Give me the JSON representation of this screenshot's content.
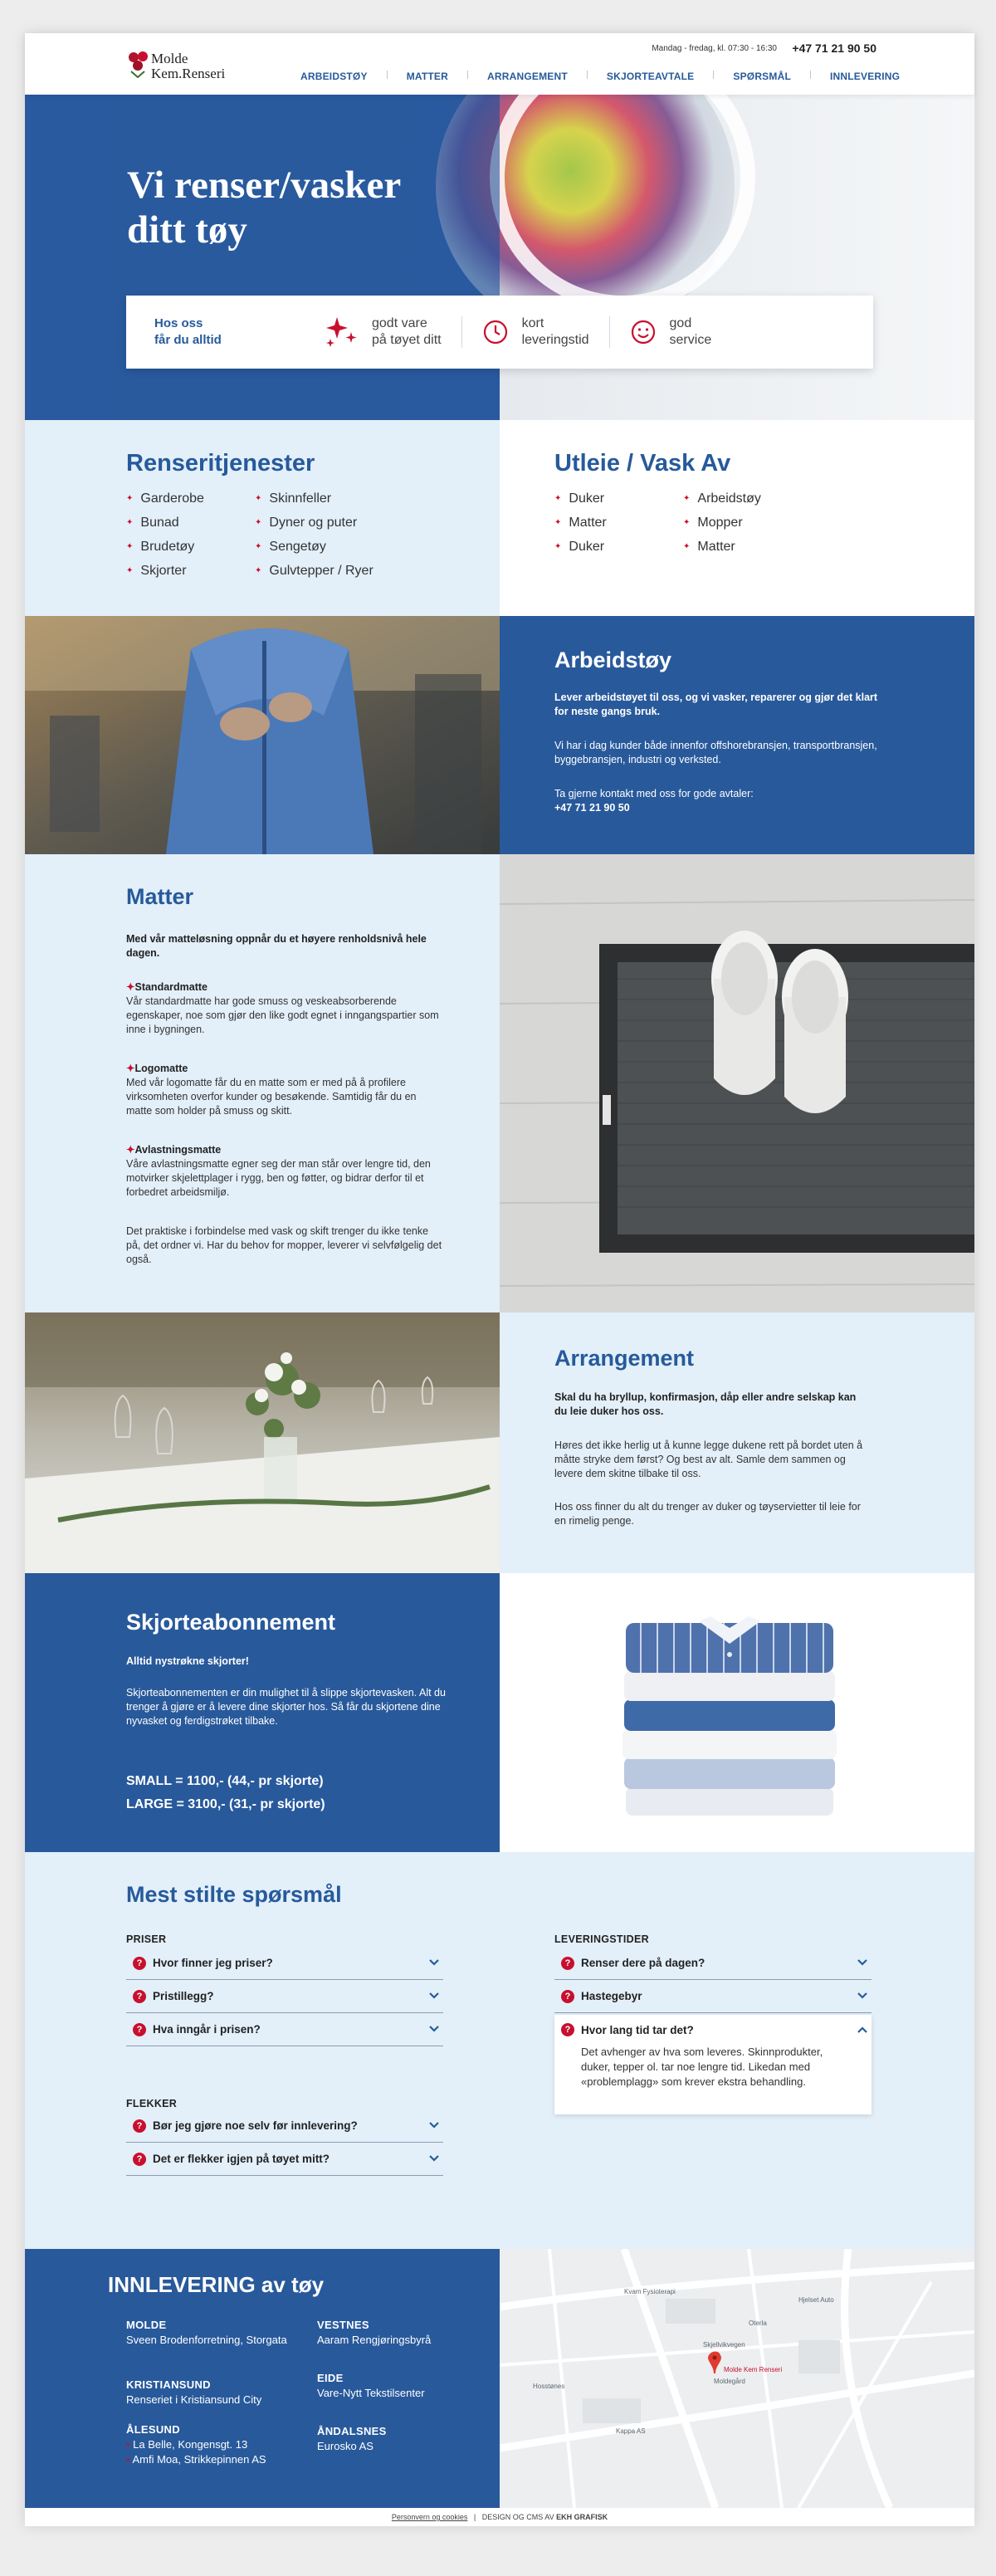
{
  "header": {
    "logo_line1": "Molde",
    "logo_line2": "Kem.Renseri",
    "hours": "Mandag - fredag, kl. 07:30 - 16:30",
    "phone": "+47 71 21 90 50",
    "nav": [
      "Arbeidstøy",
      "Matter",
      "Arrangement",
      "Skjorteavtale",
      "Spørsmål",
      "Innlevering"
    ]
  },
  "hero": {
    "title_line1": "Vi renser/vasker",
    "title_line2": "ditt tøy",
    "bar_intro_line1": "Hos oss",
    "bar_intro_line2": "får du alltid",
    "features": [
      {
        "icon": "sparkle-icon",
        "line1": "godt vare",
        "line2": "på tøyet ditt"
      },
      {
        "icon": "clock-icon",
        "line1": "kort",
        "line2": "leveringstid"
      },
      {
        "icon": "smiley-icon",
        "line1": "god",
        "line2": "service"
      }
    ]
  },
  "services": {
    "left_title": "Renseritjenester",
    "left_col1": [
      "Garderobe",
      "Bunad",
      "Brudetøy",
      "Skjorter"
    ],
    "left_col2": [
      "Skinnfeller",
      "Dyner og puter",
      "Sengetøy",
      "Gulvtepper / Ryer"
    ],
    "right_title": "Utleie / Vask Av",
    "right_col1": [
      "Duker",
      "Matter",
      "Duker"
    ],
    "right_col2": [
      "Arbeidstøy",
      "Mopper",
      "Matter"
    ]
  },
  "arbeid": {
    "title": "Arbeidstøy",
    "lead": "Lever arbeidstøyet til oss, og vi vasker, reparerer og gjør det klart for neste gangs bruk.",
    "text": "Vi har i dag kunder både innenfor offshorebransjen, transportbransjen, byggebransjen, industri og verksted.",
    "contact": "Ta gjerne kontakt med oss for gode avtaler:",
    "phone": "+47 71 21 90 50"
  },
  "matter": {
    "title": "Matter",
    "lead": "Med vår matteløsning oppnår du et høyere renholdsnivå hele dagen.",
    "items": [
      {
        "title": "Standardmatte",
        "text": "Vår standardmatte har gode smuss og veskeabsorberende egenskaper, noe som gjør den like godt egnet i inngangspartier som inne i bygningen."
      },
      {
        "title": "Logomatte",
        "text": "Med vår logomatte får du en matte som er med på å profilere virksomheten overfor kunder og besøkende. Samtidig får du en matte som holder på smuss og skitt."
      },
      {
        "title": "Avlastningsmatte",
        "text": "Våre avlastningsmatte egner seg der man står over lengre tid, den motvirker skjelettplager i rygg, ben og føtter, og bidrar derfor til et forbedret arbeidsmiljø."
      }
    ],
    "outro": "Det praktiske i forbindelse med vask og skift trenger du ikke tenke på, det ordner vi. Har du behov for mopper, leverer vi selvfølgelig det også."
  },
  "arrangement": {
    "title": "Arrangement",
    "lead": "Skal du ha bryllup, konfirmasjon, dåp eller andre selskap kan du leie duker hos oss.",
    "text1": "Høres det ikke herlig ut å kunne legge dukene rett på bordet uten å måtte stryke dem først? Og best av alt. Samle dem sammen og levere dem skitne tilbake til oss.",
    "text2": "Hos oss finner du alt du trenger av duker og tøyservietter til leie for en rimelig penge."
  },
  "skjorte": {
    "title": "Skjorteabonnement",
    "lead": "Alltid nystrøkne skjorter!",
    "text": "Skjorteabonnementen er din mulighet til å slippe skjortevasken. Alt du trenger å gjøre er å levere dine skjorter hos. Så får du skjortene dine nyvasket og ferdigstrøket tilbake.",
    "small": "SMALL = 1100,- (44,- pr skjorte)",
    "large": "LARGE = 3100,- (31,- pr skjorte)"
  },
  "faq": {
    "title": "Mest stilte spørsmål",
    "groups": [
      {
        "heading": "PRISER",
        "questions": [
          "Hvor finner jeg priser?",
          "Pristillegg?",
          "Hva inngår i prisen?"
        ]
      },
      {
        "heading": "FLEKKER",
        "questions": [
          "Bør jeg gjøre noe selv før innlevering?",
          "Det er flekker igjen på tøyet mitt?"
        ]
      },
      {
        "heading": "LEVERINGSTIDER",
        "questions": [
          "Renser dere på dagen?",
          "Hastegebyr",
          "Hvor lang tid tar det?"
        ]
      }
    ],
    "open_answer": "Det avhenger av hva som leveres. Skinnprodukter, duker, tepper ol. tar noe lengre tid. Likedan med «problemplagg» som krever ekstra behandling."
  },
  "delivery": {
    "title": "INNLEVERING av tøy",
    "molde_label": "MOLDE",
    "molde_value": "Sveen Brodenforretning, Storgata",
    "kristiansund_label": "KRISTIANSUND",
    "kristiansund_value": "Renseriet i Kristiansund City",
    "alesund_label": "ÅLESUND",
    "alesund_values": [
      "La Belle, Kongensgt. 13",
      "Amfi Moa, Strikkepinnen AS"
    ],
    "vestnes_label": "VESTNES",
    "vestnes_value": "Aaram Rengjøringsbyrå",
    "eide_label": "EIDE",
    "eide_value": "Vare-Nytt Tekstilsenter",
    "andalsnes_label": "ÅNDALSNES",
    "andalsnes_value": "Eurosko AS",
    "map_labels": [
      "Molde Kem Renseri",
      "Moldegård",
      "Kvam Fysioterapi",
      "Hjelset Auto",
      "Skjellvikvegen",
      "Hosstønes",
      "Kappa AS",
      "Oterla"
    ]
  },
  "footer": {
    "privacy": "Personvern og cookies",
    "credit_prefix": "DESIGN OG CMS AV",
    "credit_name": "EKH GRAFISK"
  },
  "colors": {
    "brand_blue": "#265a9b",
    "accent_red": "#c8102e",
    "light_blue": "#e3eff9"
  }
}
